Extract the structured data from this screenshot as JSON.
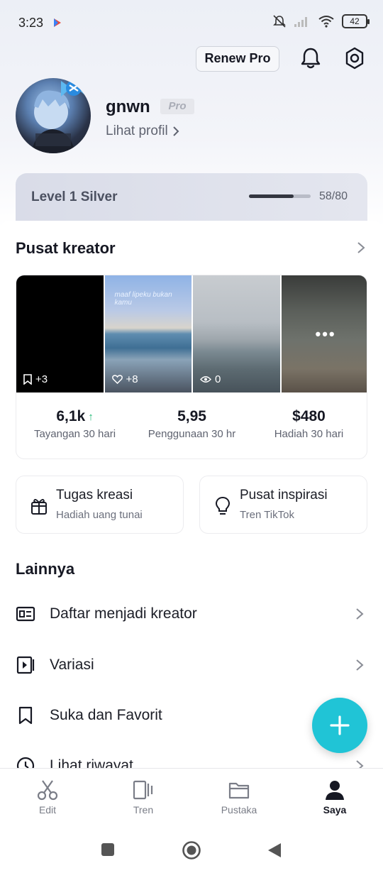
{
  "status_bar": {
    "time": "3:23",
    "battery": "42"
  },
  "header": {
    "renew_label": "Renew Pro"
  },
  "profile": {
    "username": "gnwn",
    "badge": "Pro",
    "view_profile": "Lihat profil"
  },
  "level": {
    "label": "Level 1 Silver",
    "count": "58/80",
    "progress_fraction": 0.725
  },
  "creator_center": {
    "title": "Pusat kreator",
    "thumbnails": [
      {
        "meta": "+3",
        "icon": "bookmark-icon"
      },
      {
        "meta": "+8",
        "icon": "heart-icon",
        "caption": "maaf lipeku bukan kamu"
      },
      {
        "meta": "0",
        "icon": "eye-icon"
      },
      {
        "meta": "",
        "icon": "more-dots-icon"
      }
    ],
    "stats": [
      {
        "value": "6,1k",
        "label": "Tayangan 30 hari",
        "trend": "up"
      },
      {
        "value": "5,95",
        "label": "Penggunaan 30 hr"
      },
      {
        "value": "$480",
        "label": "Hadiah 30 hari"
      }
    ]
  },
  "cards": [
    {
      "title": "Tugas kreasi",
      "subtitle": "Hadiah uang tunai",
      "icon": "gift-icon"
    },
    {
      "title": "Pusat inspirasi",
      "subtitle": "Tren TikTok",
      "icon": "lightbulb-icon"
    }
  ],
  "more": {
    "title": "Lainnya",
    "items": [
      {
        "label": "Daftar menjadi kreator",
        "icon": "id-card-icon"
      },
      {
        "label": "Variasi",
        "icon": "video-variation-icon"
      },
      {
        "label": "Suka dan Favorit",
        "icon": "bookmark-icon"
      },
      {
        "label": "Lihat riwayat",
        "icon": "history-icon"
      }
    ]
  },
  "bottom_nav": [
    {
      "label": "Edit",
      "icon": "scissors-icon"
    },
    {
      "label": "Tren",
      "icon": "trend-icon"
    },
    {
      "label": "Pustaka",
      "icon": "folder-icon"
    },
    {
      "label": "Saya",
      "icon": "person-icon",
      "active": true
    }
  ],
  "colors": {
    "accent": "#20c4d6",
    "trend_up": "#1fb874",
    "text": "#161823"
  }
}
